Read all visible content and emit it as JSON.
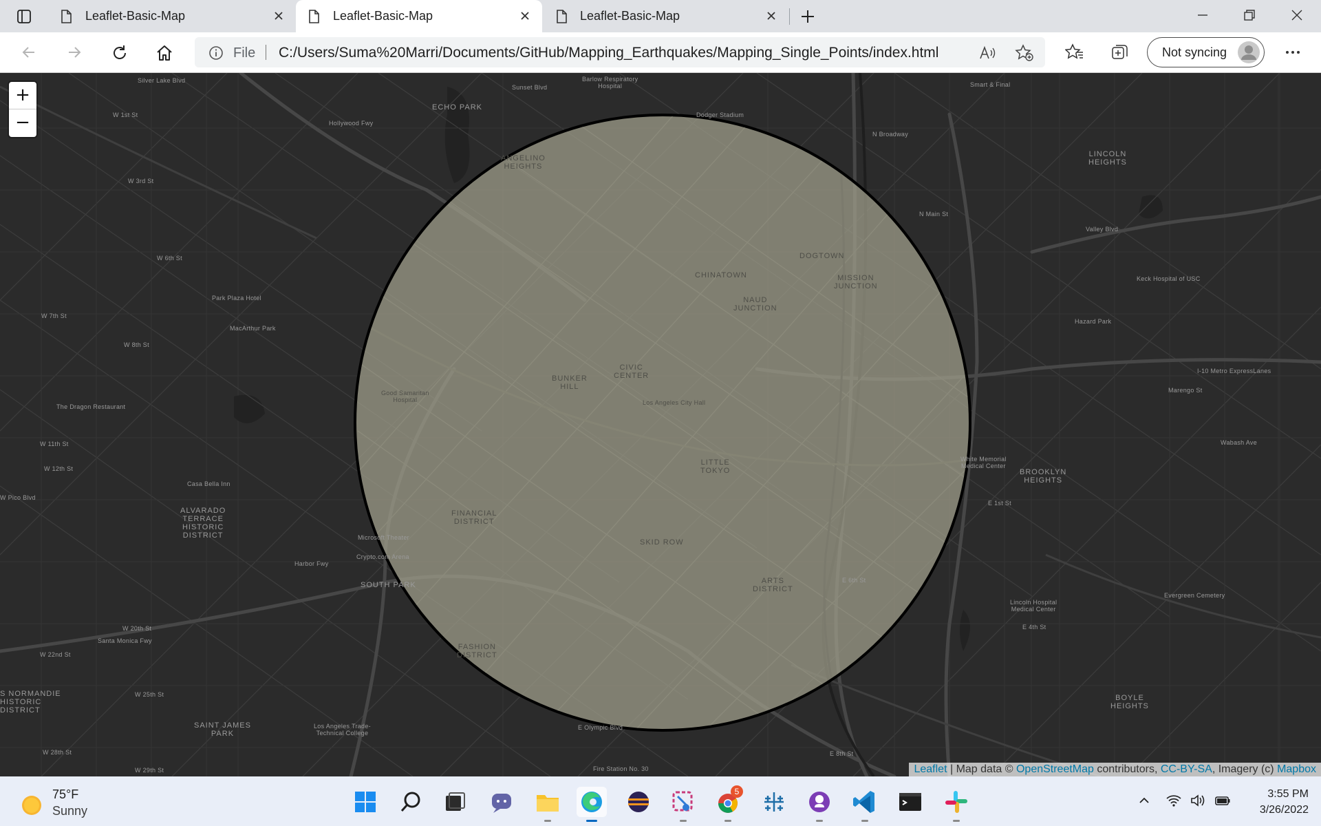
{
  "browser": {
    "tabs": [
      {
        "title": "Leaflet-Basic-Map",
        "active": false
      },
      {
        "title": "Leaflet-Basic-Map",
        "active": true
      },
      {
        "title": "Leaflet-Basic-Map",
        "active": false
      }
    ],
    "address": {
      "scheme_label": "File",
      "url": "C:/Users/Suma%20Marri/Documents/GitHub/Mapping_Earthquakes/Mapping_Single_Points/index.html"
    },
    "sync_label": "Not syncing"
  },
  "map": {
    "zoom_in": "+",
    "zoom_out": "−",
    "circle": {
      "fill": "#9d9c8a",
      "fill_opacity": 0.75,
      "stroke": "#000000"
    },
    "attribution": {
      "leaflet": "Leaflet",
      "sep": " | Map data © ",
      "osm": "OpenStreetMap",
      "contrib": " contributors, ",
      "license": "CC-BY-SA",
      "imagery": ", Imagery (c) ",
      "mapbox": "Mapbox"
    },
    "labels": {
      "echo_park": "ECHO PARK",
      "angelino": "ANGELINO\nHEIGHTS",
      "chinatown": "CHINATOWN",
      "dogtown": "DOGTOWN",
      "mission_junction": "MISSION\nJUNCTION",
      "naud": "NAUD\nJUNCTION",
      "lincoln": "LINCOLN\nHEIGHTS",
      "civic": "CIVIC\nCENTER",
      "bunker": "BUNKER\nHILL",
      "little_tokyo": "LITTLE\nTOKYO",
      "brooklyn": "BROOKLYN\nHEIGHTS",
      "financial": "FINANCIAL\nDISTRICT",
      "skid_row": "SKID ROW",
      "arts": "ARTS\nDISTRICT",
      "alvarado": "ALVARADO\nTERRACE\nHISTORIC\nDISTRICT",
      "south_park": "SOUTH PARK",
      "fashion": "FASHION\nDISTRICT",
      "saint_james": "SAINT JAMES\nPARK",
      "boyle": "BOYLE\nHEIGHTS",
      "normandie": "S NORMANDIE\nHISTORIC\nDISTRICT",
      "silver_lake_blvd": "Silver Lake Blvd",
      "w1st": "W 1st St",
      "w3rd": "W 3rd St",
      "w6th": "W 6th St",
      "w7th": "W 7th St",
      "w8th": "W 8th St",
      "w11th": "W 11th St",
      "w12th": "W 12th St",
      "pico": "W Pico Blvd",
      "w20th": "W 20th St",
      "w22nd": "W 22nd St",
      "w25th": "W 25th St",
      "w28th": "W 28th St",
      "w29th": "W 29th St",
      "santa_monica": "Santa Monica Fwy",
      "i10": "I-10 Metro ExpressLanes",
      "dodger": "Dodger Stadium",
      "barlow": "Barlow Respiratory\nHospital",
      "macarthur": "MacArthur Park",
      "park_plaza": "Park Plaza Hotel",
      "good_sam": "Good Samaritan\nHospital",
      "la_city_hall": "Los Angeles City Hall",
      "crypto": "Crypto.com Arena",
      "microsoft": "Microsoft Theater",
      "keck": "Keck Hospital of USC",
      "hazard": "Hazard Park",
      "lincoln_hosp": "Lincoln Hospital\nMedical Center",
      "evergreen": "Evergreen Cemetery",
      "white_memorial": "White Memorial\nMedical Center",
      "fire_station": "Fire Station No. 30",
      "la_trade": "Los Angeles Trade-\nTechnical College",
      "dragon": "The Dragon Restaurant",
      "casa_bella": "Casa Bella Inn",
      "n_broadway": "N Broadway",
      "smart_final": "Smart & Final",
      "n_main": "N Main St",
      "valley_blvd": "Valley Blvd",
      "marengo": "Marengo St",
      "wabash": "Wabash Ave",
      "e_1st": "E 1st St",
      "e_4th": "E 4th St",
      "e_6th": "E 6th St",
      "olympic": "E Olympic Blvd",
      "e_8th": "E 8th St",
      "sunset": "Sunset Blvd",
      "hollywood_fwy": "Hollywood Fwy",
      "harbor_fwy": "Harbor Fwy"
    }
  },
  "taskbar": {
    "weather_temp": "75°F",
    "weather_cond": "Sunny",
    "time": "3:55 PM",
    "date": "3/26/2022",
    "apps": [
      "start",
      "search",
      "task-view",
      "chat",
      "file-explorer",
      "edge",
      "eclipse",
      "snipping-tool",
      "chrome",
      "tableau",
      "github-desktop",
      "vscode",
      "terminal",
      "slack"
    ],
    "chrome_badge": "5"
  }
}
